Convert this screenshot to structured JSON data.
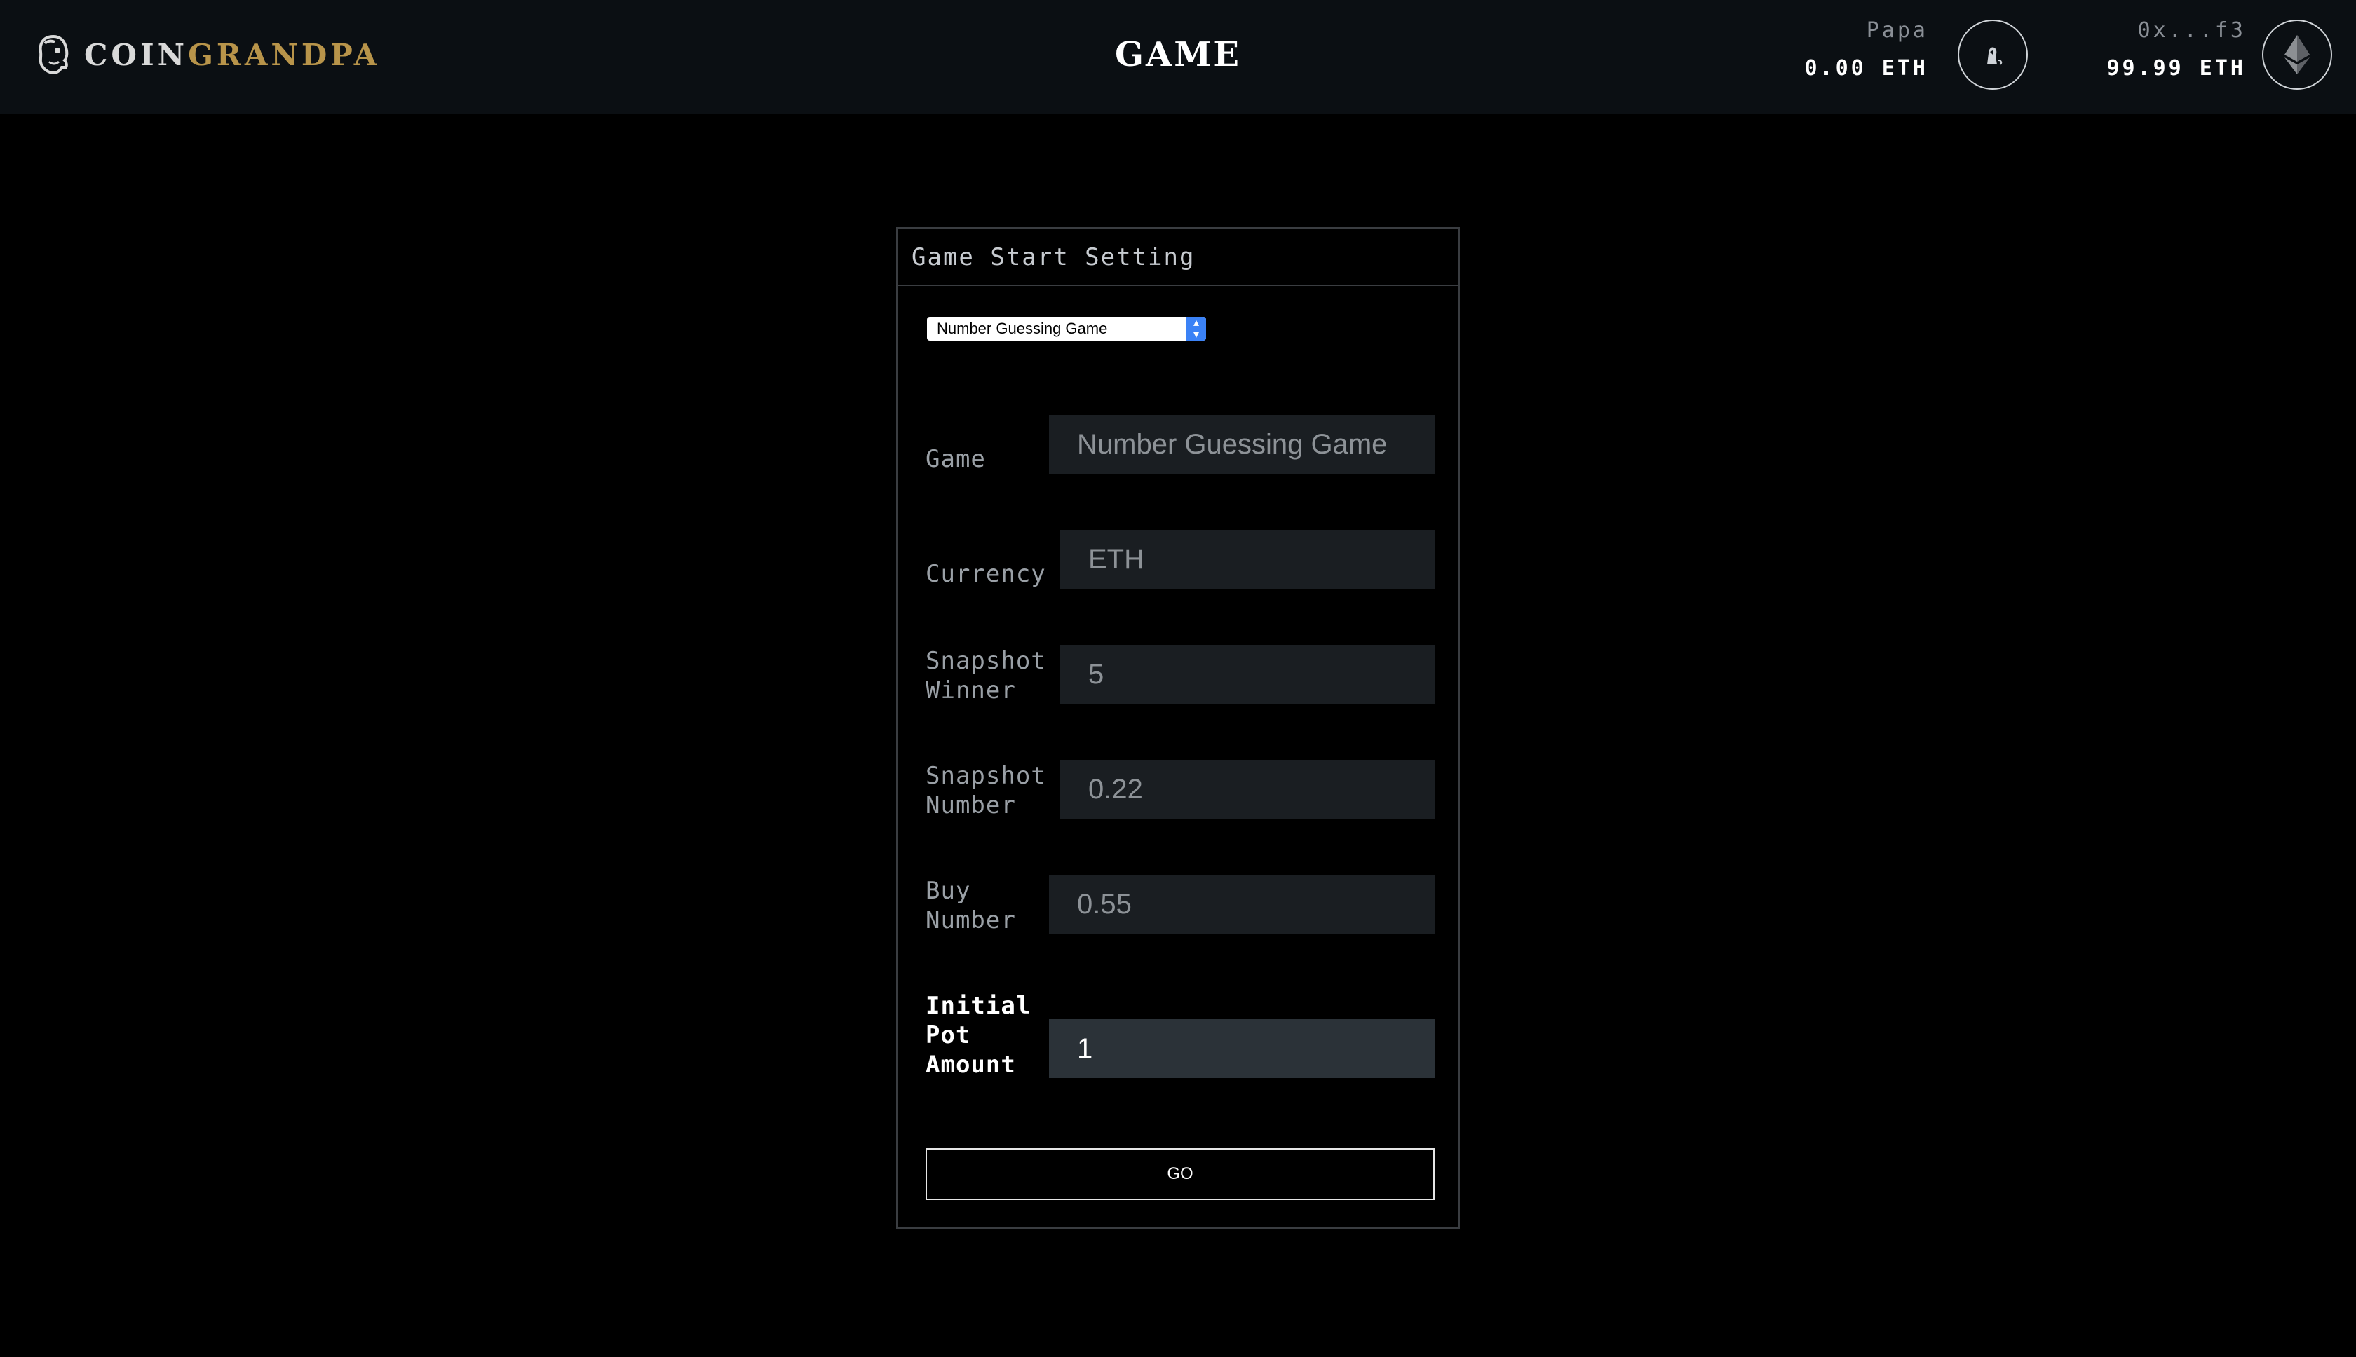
{
  "header": {
    "logo": {
      "part1": "COIN",
      "part2": "GRANDPA"
    },
    "title": "GAME",
    "accounts": [
      {
        "name": "Papa",
        "balance": "0.00 ETH",
        "icon": "papa-token-icon"
      },
      {
        "name": "0x...f3",
        "balance": "99.99 ETH",
        "icon": "ethereum-icon"
      }
    ]
  },
  "panel": {
    "title": "Game Start Setting",
    "game_select": {
      "selected": "Number Guessing Game"
    },
    "fields": [
      {
        "label_lines": [
          "Game"
        ],
        "value": "Number Guessing Game"
      },
      {
        "label_lines": [
          "Currency"
        ],
        "value": "ETH"
      },
      {
        "label_lines": [
          "Snapshot",
          "Winner"
        ],
        "value": "5"
      },
      {
        "label_lines": [
          "Snapshot",
          "Number"
        ],
        "value": "0.22"
      },
      {
        "label_lines": [
          "Buy",
          "Number"
        ],
        "value": "0.55"
      },
      {
        "label_lines": [
          "Initial",
          "Pot",
          "Amount"
        ],
        "value": "1"
      }
    ],
    "go_label": "GO"
  },
  "colors": {
    "background": "#000000",
    "header_bg": "#0b0f13",
    "accent_gold": "#b8944a",
    "input_bg": "#1a1e22",
    "input_active_bg": "#2b3238"
  }
}
